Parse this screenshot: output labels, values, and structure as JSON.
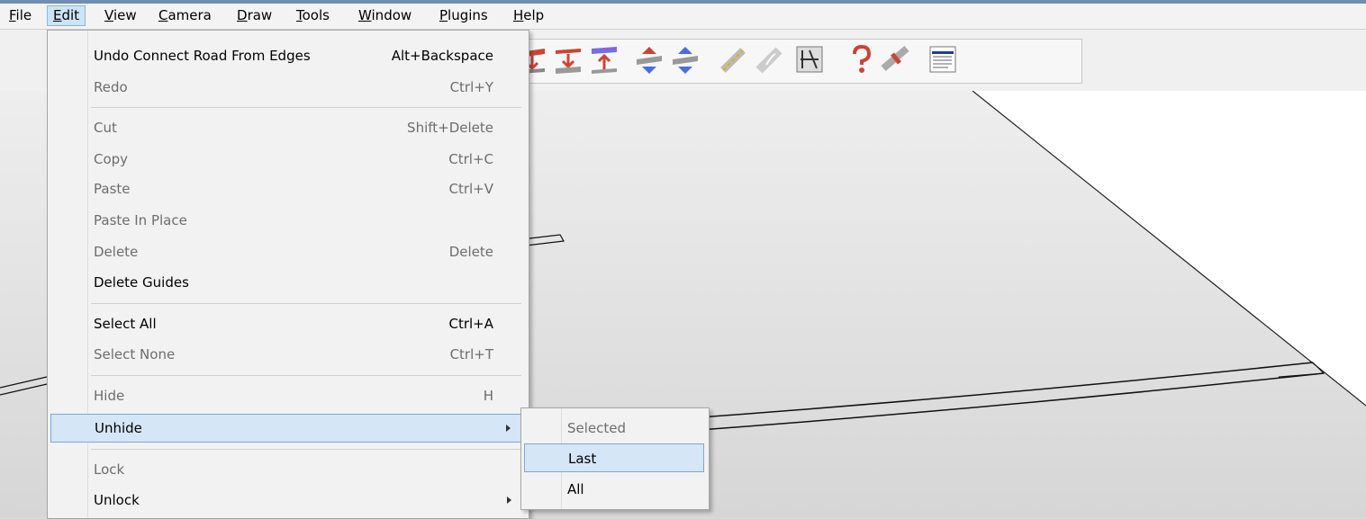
{
  "menubar": {
    "items": [
      "File",
      "Edit",
      "View",
      "Camera",
      "Draw",
      "Tools",
      "Window",
      "Plugins",
      "Help"
    ],
    "active": "Edit"
  },
  "edit_menu": {
    "items": [
      {
        "label": "Undo Connect Road From Edges",
        "shortcut": "Alt+Backspace",
        "enabled": true
      },
      {
        "label": "Redo",
        "shortcut": "Ctrl+Y",
        "enabled": false
      },
      {
        "label": "Cut",
        "shortcut": "Shift+Delete",
        "enabled": false
      },
      {
        "label": "Copy",
        "shortcut": "Ctrl+C",
        "enabled": false
      },
      {
        "label": "Paste",
        "shortcut": "Ctrl+V",
        "enabled": false
      },
      {
        "label": "Paste In Place",
        "shortcut": "",
        "enabled": false
      },
      {
        "label": "Delete",
        "shortcut": "Delete",
        "enabled": false
      },
      {
        "label": "Delete Guides",
        "shortcut": "",
        "enabled": true
      },
      {
        "label": "Select All",
        "shortcut": "Ctrl+A",
        "enabled": true
      },
      {
        "label": "Select None",
        "shortcut": "Ctrl+T",
        "enabled": false
      },
      {
        "label": "Hide",
        "shortcut": "H",
        "enabled": false
      },
      {
        "label": "Unhide",
        "shortcut": "",
        "enabled": true,
        "submenu": true,
        "highlighted": true
      },
      {
        "label": "Lock",
        "shortcut": "",
        "enabled": false
      },
      {
        "label": "Unlock",
        "shortcut": "",
        "enabled": true,
        "submenu": true
      }
    ]
  },
  "unhide_submenu": {
    "items": [
      {
        "label": "Selected",
        "enabled": false
      },
      {
        "label": "Last",
        "enabled": true,
        "highlighted": true
      },
      {
        "label": "All",
        "enabled": true
      }
    ]
  },
  "toolbar": {
    "icons": [
      "road-lower-icon",
      "road-flatten-icon",
      "road-raise-icon",
      "move-up-icon",
      "move-down-icon",
      "draw-path-icon",
      "curve-icon",
      "intersection-icon",
      "help-icon",
      "wizard-icon",
      "options-list-icon"
    ]
  },
  "colors": {
    "highlight": "#d5e6f7",
    "highlight_border": "#7ca7d8",
    "menu_bg": "#f2f2f2",
    "disabled_text": "#6d6d6d"
  }
}
